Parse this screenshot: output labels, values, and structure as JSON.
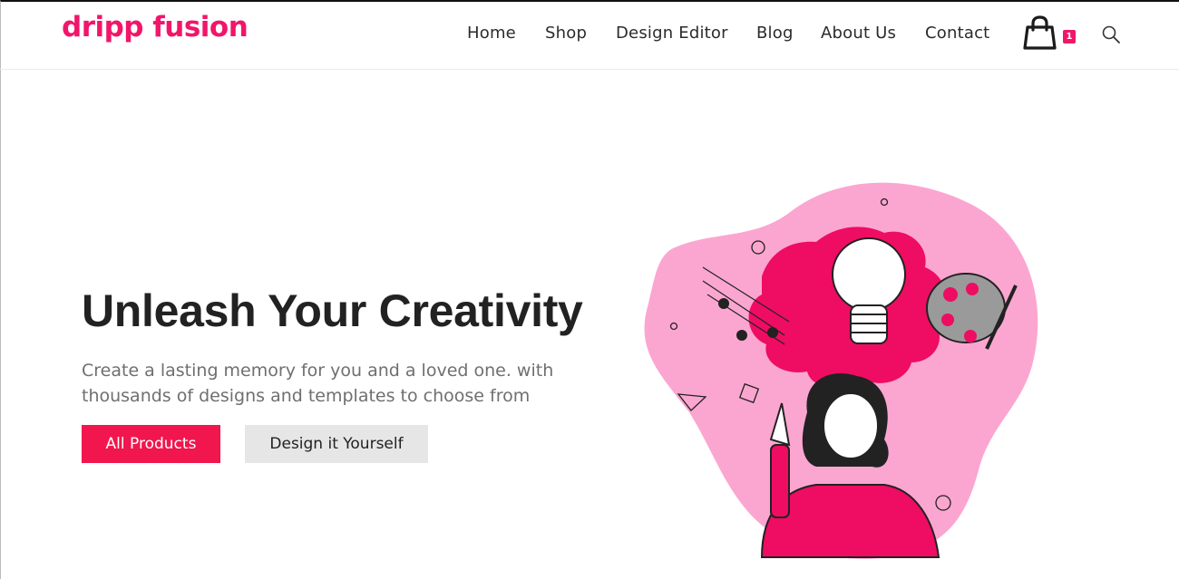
{
  "brand": {
    "logo_text": "dripp fusion",
    "accent_color": "#f1166a"
  },
  "nav": {
    "items": [
      {
        "label": "Home"
      },
      {
        "label": "Shop"
      },
      {
        "label": "Design Editor"
      },
      {
        "label": "Blog"
      },
      {
        "label": "About Us"
      },
      {
        "label": "Contact"
      }
    ],
    "cart_icon": "shopping-bag-icon",
    "cart_count": "1",
    "search_icon": "search-icon"
  },
  "hero": {
    "title": "Unleash Your Creativity",
    "subtitle": "Create a lasting memory for you and a loved one. with thousands of designs and templates to choose from",
    "primary_button": "All Products",
    "secondary_button": "Design it Yourself",
    "primary_color": "#f1164d",
    "secondary_color": "#e6e6e6",
    "illustration": "woman-creativity-illustration"
  }
}
